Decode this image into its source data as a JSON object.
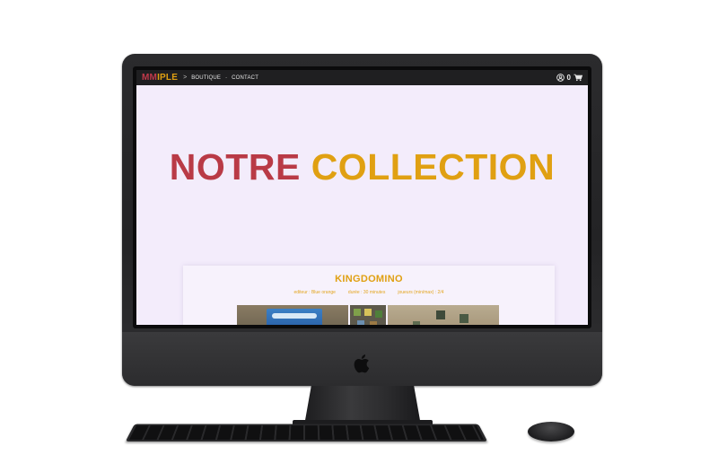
{
  "site": {
    "brand": {
      "part1": "MM",
      "part2": "IPLE"
    },
    "nav": {
      "separator": ">",
      "links": [
        "BOUTIQUE",
        "CONTACT"
      ],
      "link_separator": "-"
    },
    "cart": {
      "count": "0",
      "icons": [
        "user-icon",
        "cart-icon"
      ]
    },
    "hero": {
      "word1": "NOTRE",
      "word2": "COLLECTION"
    },
    "product": {
      "title": "KINGDOMINO",
      "meta": {
        "publisher": "editeur : Blue orange",
        "duration": "durée : 30 minutes",
        "players": "joueurs (min/max) : 2/4"
      }
    }
  },
  "colors": {
    "brand_red": "#c0394a",
    "brand_gold": "#e0a012",
    "page_bg": "#f3ecfb",
    "navbar_bg": "#1f1f21"
  }
}
